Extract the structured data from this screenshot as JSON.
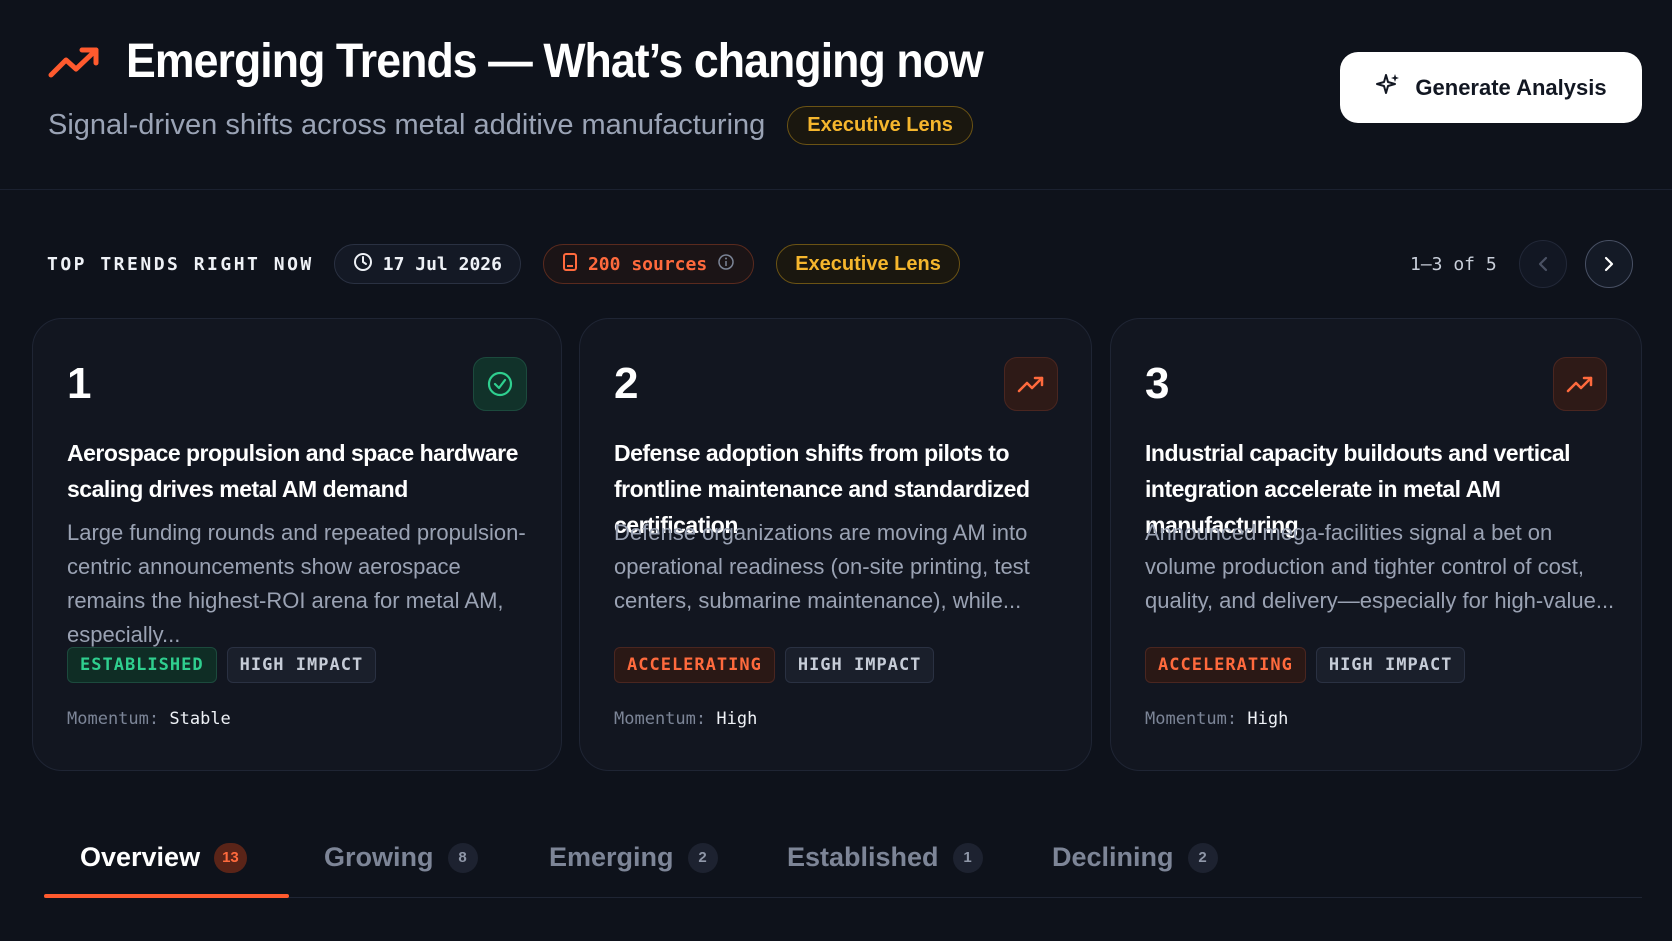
{
  "header": {
    "title": "Emerging Trends — What’s changing now",
    "subtitle": "Signal-driven shifts across metal additive manufacturing",
    "lens_label": "Executive Lens",
    "generate_label": "Generate Analysis",
    "title_icon": "trending-up-icon",
    "generate_icon": "sparkles-icon"
  },
  "top_trends": {
    "label": "TOP TRENDS RIGHT NOW",
    "date": "17 Jul 2026",
    "sources": "200 sources",
    "lens_label": "Executive Lens",
    "pagination": "1–3 of 5"
  },
  "cards": [
    {
      "number": "1",
      "icon": "check-circle-icon",
      "title": "Aerospace propulsion and space hardware scaling drives metal AM demand",
      "description": "Large funding rounds and repeated propulsion-centric announcements show aerospace remains the highest-ROI arena for metal AM, especially...",
      "status": "ESTABLISHED",
      "impact": "HIGH IMPACT",
      "momentum_label": "Momentum:",
      "momentum_value": "Stable"
    },
    {
      "number": "2",
      "icon": "trending-up-icon",
      "title": "Defense adoption shifts from pilots to frontline maintenance and standardized certification",
      "description": "Defense organizations are moving AM into operational readiness (on-site printing, test centers, submarine maintenance), while...",
      "status": "ACCELERATING",
      "impact": "HIGH IMPACT",
      "momentum_label": "Momentum:",
      "momentum_value": "High"
    },
    {
      "number": "3",
      "icon": "trending-up-icon",
      "title": "Industrial capacity buildouts and vertical integration accelerate in metal AM manufacturing",
      "description": "Announced mega-facilities signal a bet on volume production and tighter control of cost, quality, and delivery—especially for high-value...",
      "status": "ACCELERATING",
      "impact": "HIGH IMPACT",
      "momentum_label": "Momentum:",
      "momentum_value": "High"
    }
  ],
  "tabs": [
    {
      "label": "Overview",
      "count": "13",
      "active": true
    },
    {
      "label": "Growing",
      "count": "8"
    },
    {
      "label": "Emerging",
      "count": "2"
    },
    {
      "label": "Established",
      "count": "1"
    },
    {
      "label": "Declining",
      "count": "2"
    }
  ],
  "colors": {
    "background": "#0e121b",
    "accent": "#ff5a2e",
    "lens": "#f5b62d",
    "established": "#2fcf8f"
  }
}
